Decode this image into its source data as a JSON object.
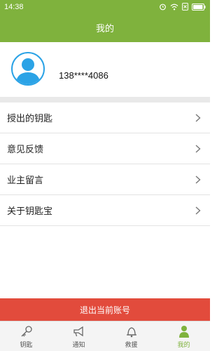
{
  "status_bar": {
    "time": "14:38"
  },
  "header": {
    "title": "我的"
  },
  "profile": {
    "phone": "138****4086"
  },
  "menu": {
    "items": [
      {
        "label": "授出的钥匙"
      },
      {
        "label": "意见反馈"
      },
      {
        "label": "业主留言"
      },
      {
        "label": "关于钥匙宝"
      }
    ]
  },
  "logout": {
    "label": "退出当前账号"
  },
  "tabs": [
    {
      "label": "钥匙",
      "icon": "key-icon"
    },
    {
      "label": "通知",
      "icon": "megaphone-icon"
    },
    {
      "label": "救援",
      "icon": "bell-icon"
    },
    {
      "label": "我的",
      "icon": "person-icon",
      "active": true
    }
  ],
  "colors": {
    "brand_green": "#7fb23d",
    "logout_red": "#e24b3c",
    "avatar_blue": "#2ba3e6"
  }
}
